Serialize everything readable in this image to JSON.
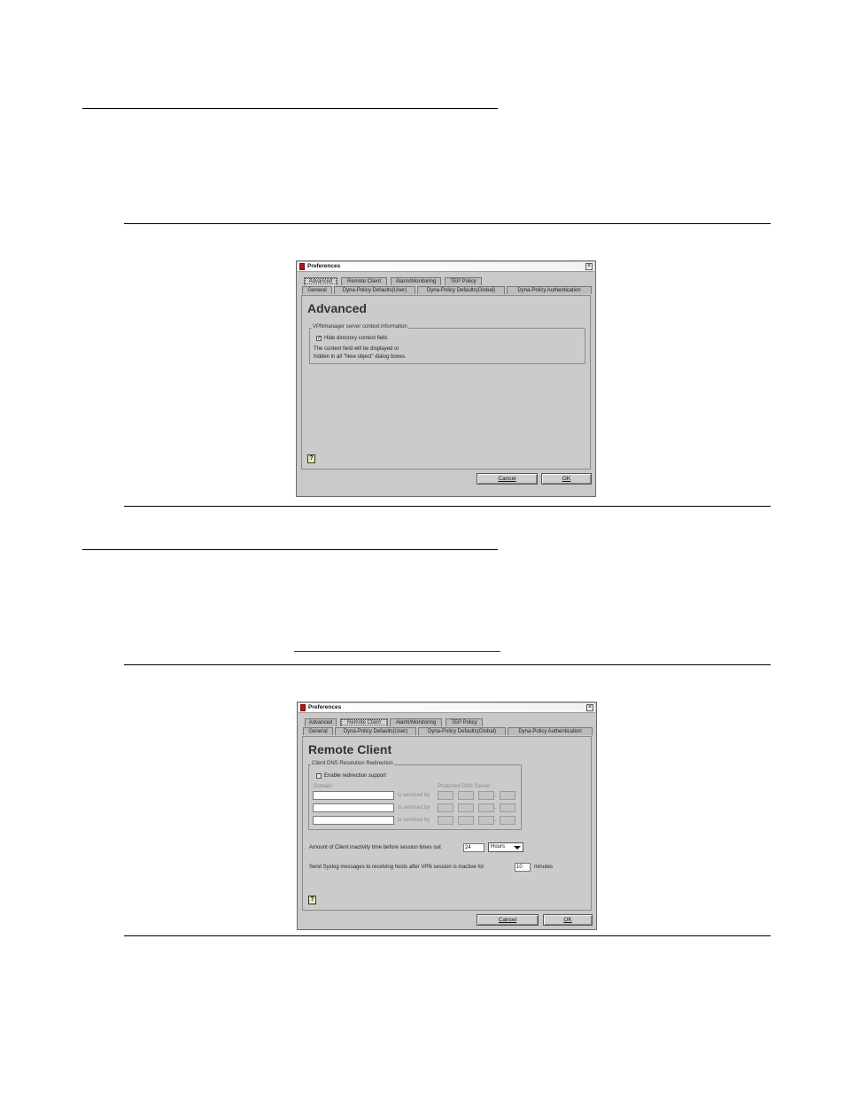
{
  "dialog1": {
    "title": "Preferences",
    "close_glyph": "×",
    "tabs_row1": [
      "Advanced",
      "Remote Client",
      "Alarm/Monitoring",
      "TEP Policy"
    ],
    "tabs_row2": [
      "General",
      "Dyna-Policy Defaults(User)",
      "Dyna-Policy Defaults(Global)",
      "Dyna-Policy Authentication"
    ],
    "panel_title": "Advanced",
    "group_label": "VPNmanager server context information",
    "checkbox_label": "Hide directory context field.",
    "checkbox_checked": true,
    "check_glyph": "✓",
    "description_line1": "The context field will be displayed or",
    "description_line2": "hidden in all \"New object\" dialog boxes.",
    "help_glyph": "?",
    "cancel_label": "Cancel",
    "ok_label": "OK"
  },
  "dialog2": {
    "title": "Preferences",
    "close_glyph": "×",
    "tabs_row1": [
      "Advanced",
      "Remote Client",
      "Alarm/Monitoring",
      "TEP Policy"
    ],
    "tabs_row2": [
      "General",
      "Dyna-Policy Defaults(User)",
      "Dyna-Policy Defaults(Global)",
      "Dyna-Policy Authentication"
    ],
    "panel_title": "Remote Client",
    "group_label": "Client DNS Resolution Redirection",
    "checkbox_label": "Enable redirection support",
    "checkbox_checked": false,
    "domain_header": "Domain",
    "dns_header": "Protected DNS Server",
    "serviced_by": "is serviced by",
    "ip_dot": ".",
    "inactivity_label": "Amount of Client inactivity time before session times out",
    "inactivity_value": "24",
    "inactivity_unit": "Hours",
    "syslog_label": "Send Syslog messages to receiving hosts after VPN session is inactive for",
    "syslog_value": "10",
    "syslog_unit": "minutes",
    "help_glyph": "?",
    "cancel_label": "Cancel",
    "ok_label": "OK"
  }
}
